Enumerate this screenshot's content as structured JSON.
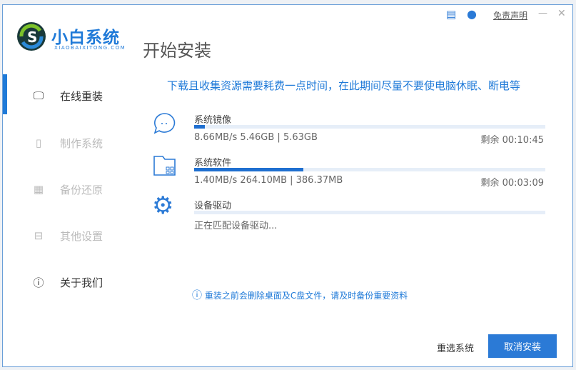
{
  "app": {
    "logo_text": "小白系统",
    "logo_sub": "XIAOBAIXITONG.COM",
    "title": "开始安装"
  },
  "titlebar": {
    "disclaimer": "免责声明",
    "minimize": "—",
    "close": "✕"
  },
  "sidebar": {
    "items": [
      {
        "label": "在线重装",
        "icon": "monitor-icon",
        "active": true
      },
      {
        "label": "制作系统",
        "icon": "usb-icon",
        "active": false
      },
      {
        "label": "备份还原",
        "icon": "backup-icon",
        "active": false
      },
      {
        "label": "其他设置",
        "icon": "toolbox-icon",
        "active": false
      },
      {
        "label": "关于我们",
        "icon": "info-icon",
        "active": true
      }
    ]
  },
  "notice": "下载且收集资源需要耗费一点时间，在此期间尽量不要使电脑休眠、断电等",
  "tasks": [
    {
      "title": "系统镜像",
      "icon": "chat-bubble-icon",
      "progress": 0.03,
      "stats": "8.66MB/s 5.46GB | 5.63GB",
      "remaining": "剩余 00:10:45"
    },
    {
      "title": "系统软件",
      "icon": "folder-apps-icon",
      "progress": 0.31,
      "stats": "1.40MB/s 264.10MB | 386.37MB",
      "remaining": "剩余 00:03:09"
    },
    {
      "title": "设备驱动",
      "icon": "gear-icon",
      "progress": 0,
      "stats": "正在匹配设备驱动...",
      "remaining": ""
    }
  ],
  "warning": "重装之前会删除桌面及C盘文件，请及时备份重要资料",
  "buttons": {
    "reselect": "重选系统",
    "cancel": "取消安装"
  },
  "colors": {
    "accent": "#1f7ad8"
  }
}
